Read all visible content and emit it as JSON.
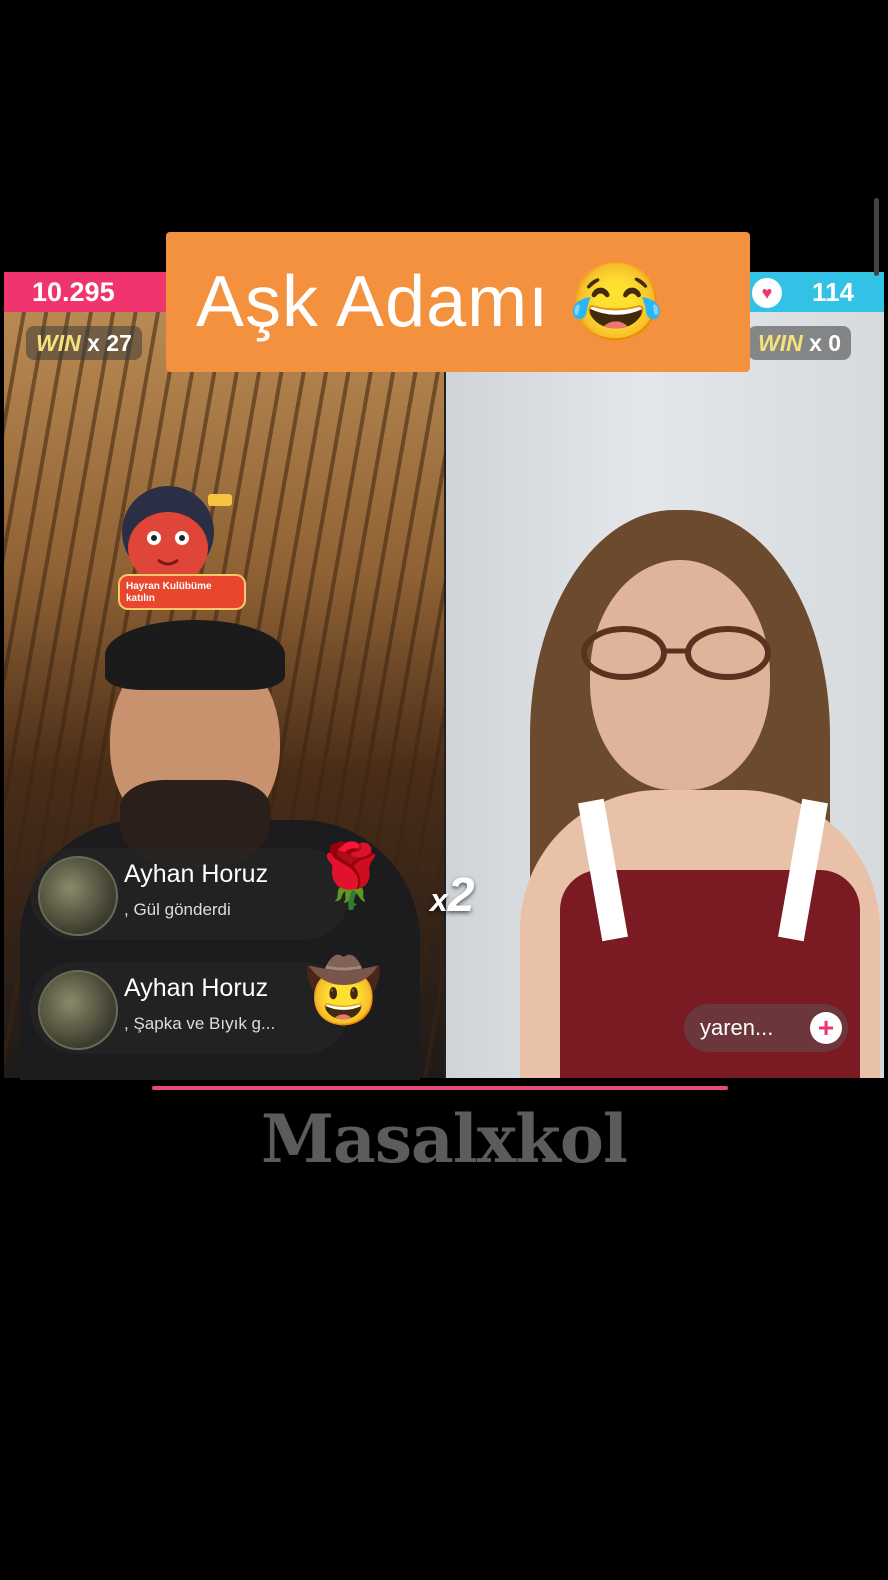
{
  "battle": {
    "left": {
      "score": "10.295",
      "win_label": "WIN",
      "win_count": "x 27"
    },
    "right": {
      "score": "114",
      "win_label": "WIN",
      "win_count": "x 0"
    }
  },
  "title": {
    "text": "Aşk Adamı",
    "emoji": "😂"
  },
  "fanclub": {
    "label": "Hayran Kulübüme katılın"
  },
  "gifts": [
    {
      "name": "Ayhan Horuz",
      "desc": ", Gül  gönderdi",
      "icon": "🌹"
    },
    {
      "name": "Ayhan Horuz",
      "desc": ", Şapka ve Bıyık  g...",
      "icon": "🤠"
    }
  ],
  "multiplier": {
    "x": "x",
    "value": "2"
  },
  "follow": {
    "label": "yaren...",
    "plus": "+"
  },
  "watermark": "Masalxkol",
  "colors": {
    "left_team": "#f0356e",
    "right_team": "#33c2e6",
    "banner": "#f4913e"
  }
}
